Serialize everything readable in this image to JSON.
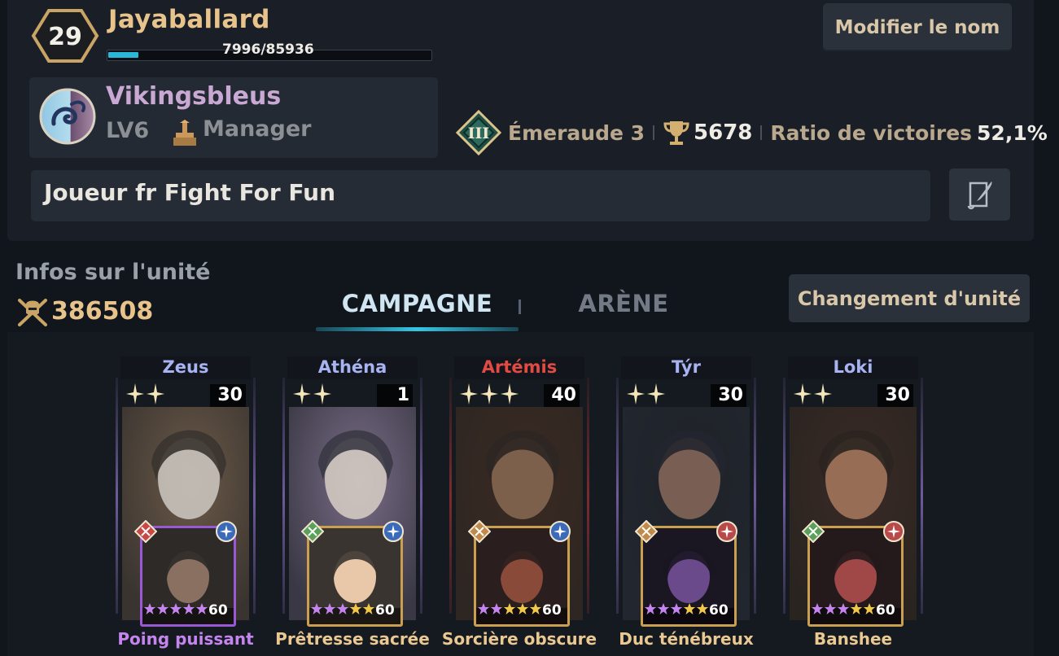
{
  "colors": {
    "gold": "#e8c48c",
    "accent_cyan": "#2bb8d8",
    "guild_purple": "#c9a9d4",
    "hero_god": "#a8b3f2",
    "hero_red": "#e24b43",
    "sub_purple": "#c585ee",
    "sub_gold": "#eac892"
  },
  "player": {
    "level": "29",
    "name": "Jayaballard",
    "xp_text": "7996/85936",
    "xp_fraction": 0.093,
    "rename_label": "Modifier le nom",
    "motto": "Joueur fr Fight For Fun",
    "edit_icon": "quill-scroll-icon"
  },
  "guild": {
    "name": "Vikingsbleus",
    "level": "LV6",
    "role": "Manager",
    "emblem_icon": "swirl-emblem-icon",
    "role_icon": "throne-icon"
  },
  "stats": {
    "rank_icon": "rank-roman-three-icon",
    "rank_name": "Émeraude 3",
    "trophy_icon": "trophy-icon",
    "trophies": "5678",
    "ratio_label": "Ratio de victoires",
    "ratio_value": "52,1%"
  },
  "units": {
    "title": "Infos sur l'unité",
    "power_icon": "crossed-swords-helmet-icon",
    "power": "386508",
    "tabs": [
      "CAMPAGNE",
      "ARÈNE"
    ],
    "active_tab": "CAMPAGNE",
    "change_label": "Changement d'unité"
  },
  "heroes": [
    {
      "name": "Zeus",
      "level": "30",
      "stars": 2,
      "frame": "#6e5a9a",
      "name_color": "#a8b3f2",
      "sub": {
        "name": "Poing puissant",
        "level": "60",
        "stars_purple": 5,
        "stars_gold": 0,
        "name_color": "#c585ee",
        "left_icon": "crossed-swords-icon",
        "right_icon": "sparkle-icon"
      }
    },
    {
      "name": "Athéna",
      "level": "1",
      "stars": 2,
      "frame": "#6e5a9a",
      "name_color": "#a8b3f2",
      "sub": {
        "name": "Prêtresse sacrée",
        "level": "60",
        "stars_purple": 3,
        "stars_gold": 2,
        "name_color": "#eac892",
        "left_icon": "cross-diamond-icon",
        "right_icon": "sparkle-icon"
      }
    },
    {
      "name": "Artémis",
      "level": "40",
      "stars": 3,
      "frame": "#7d2b2b",
      "name_color": "#e24b43",
      "sub": {
        "name": "Sorcière obscure",
        "level": "60",
        "stars_purple": 2,
        "stars_gold": 3,
        "name_color": "#eac892",
        "left_icon": "bow-icon",
        "right_icon": "sparkle-icon"
      }
    },
    {
      "name": "Týr",
      "level": "30",
      "stars": 2,
      "frame": "#6e5a9a",
      "name_color": "#a8b3f2",
      "sub": {
        "name": "Duc ténébreux",
        "level": "60",
        "stars_purple": 3,
        "stars_gold": 2,
        "name_color": "#eac892",
        "left_icon": "bow-icon",
        "right_icon": "flame-icon"
      }
    },
    {
      "name": "Loki",
      "level": "30",
      "stars": 2,
      "frame": "#6e5a9a",
      "name_color": "#a8b3f2",
      "sub": {
        "name": "Banshee",
        "level": "60",
        "stars_purple": 3,
        "stars_gold": 2,
        "name_color": "#eac892",
        "left_icon": "cross-diamond-icon",
        "right_icon": "flame-icon"
      }
    }
  ]
}
